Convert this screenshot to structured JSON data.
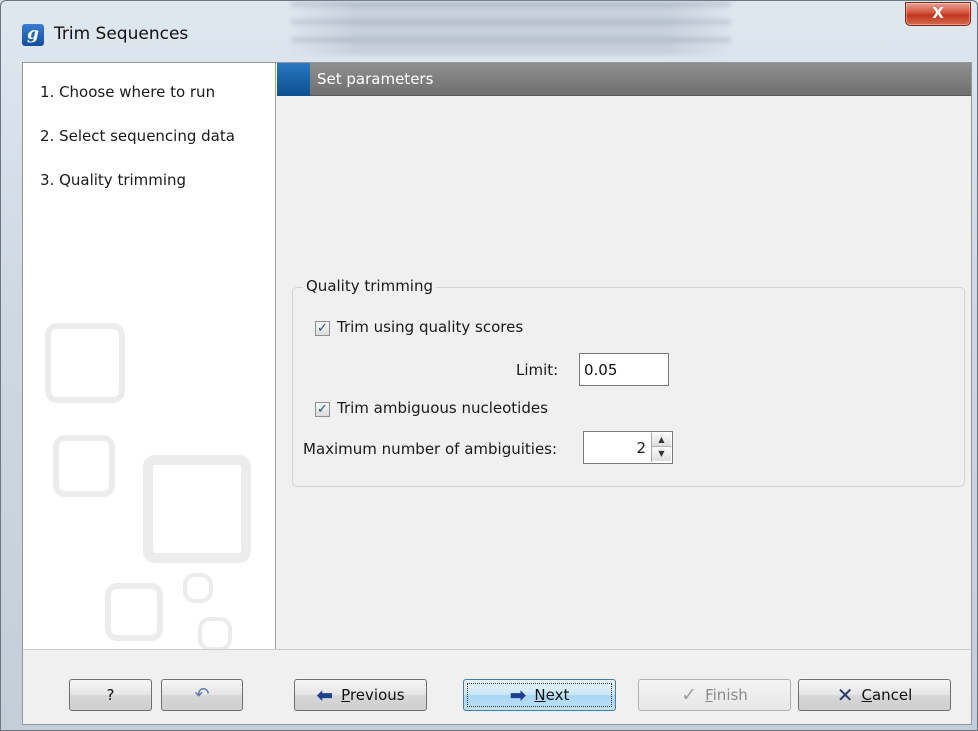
{
  "window": {
    "title": "Trim Sequences",
    "app_icon_letter": "g",
    "close_label": "X"
  },
  "steps": [
    {
      "label": "1.  Choose where to run"
    },
    {
      "label": "2.  Select sequencing data"
    },
    {
      "label": "3.  Quality trimming"
    }
  ],
  "panel": {
    "header": "Set parameters"
  },
  "quality_trimming": {
    "legend": "Quality trimming",
    "trim_quality": {
      "label": "Trim using quality scores",
      "checked": true
    },
    "limit": {
      "label": "Limit:",
      "value": "0.05"
    },
    "trim_ambiguous": {
      "label": "Trim ambiguous nucleotides",
      "checked": true
    },
    "max_ambiguities": {
      "label": "Maximum number of ambiguities:",
      "value": "2"
    }
  },
  "footer": {
    "help_label": "?",
    "previous": {
      "prefix": "",
      "mnemonic": "P",
      "rest": "revious"
    },
    "next": {
      "prefix": "",
      "mnemonic": "N",
      "rest": "ext"
    },
    "finish": {
      "prefix": "",
      "mnemonic": "F",
      "rest": "inish"
    },
    "cancel": {
      "prefix": "",
      "mnemonic": "C",
      "rest": "ancel"
    }
  },
  "icons": {
    "app": "clc-g-icon",
    "help": "question-mark-icon",
    "reset": "undo-arrow-icon",
    "previous": "arrow-left-icon",
    "next": "arrow-right-icon",
    "finish": "checkmark-icon",
    "cancel": "x-icon"
  },
  "colors": {
    "header_accent": "#1464a8",
    "close_button": "#c7402a",
    "primary_button": "#a9d6f3"
  }
}
